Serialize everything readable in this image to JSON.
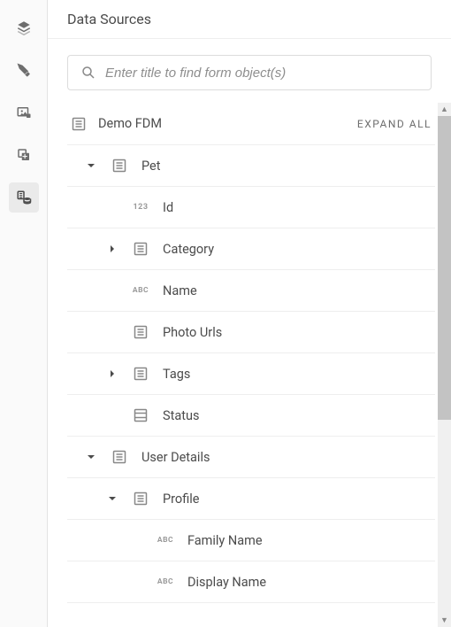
{
  "header": {
    "title": "Data Sources"
  },
  "search": {
    "placeholder": "Enter title to find form object(s)"
  },
  "root": {
    "label": "Demo FDM",
    "expand_all": "EXPAND ALL"
  },
  "nodes": [
    {
      "label": "Pet",
      "level": 1,
      "type": "object",
      "expanded": true,
      "has_children": true
    },
    {
      "label": "Id",
      "level": 2,
      "type": "number",
      "expanded": false,
      "has_children": false
    },
    {
      "label": "Category",
      "level": 2,
      "type": "object",
      "expanded": false,
      "has_children": true
    },
    {
      "label": "Name",
      "level": 2,
      "type": "string",
      "expanded": false,
      "has_children": false
    },
    {
      "label": "Photo Urls",
      "level": 2,
      "type": "array",
      "expanded": false,
      "has_children": false
    },
    {
      "label": "Tags",
      "level": 2,
      "type": "object",
      "expanded": false,
      "has_children": true
    },
    {
      "label": "Status",
      "level": 2,
      "type": "enum",
      "expanded": false,
      "has_children": false
    },
    {
      "label": "User Details",
      "level": 1,
      "type": "object",
      "expanded": true,
      "has_children": true
    },
    {
      "label": "Profile",
      "level": 2,
      "type": "object",
      "expanded": true,
      "has_children": true
    },
    {
      "label": "Family Name",
      "level": 3,
      "type": "string",
      "expanded": false,
      "has_children": false
    },
    {
      "label": "Display Name",
      "level": 3,
      "type": "string",
      "expanded": false,
      "has_children": false
    }
  ],
  "rail": {
    "active_index": 4,
    "items": [
      {
        "name": "layers-icon",
        "title": "Layers"
      },
      {
        "name": "wrench-icon",
        "title": "Tools"
      },
      {
        "name": "image-icon",
        "title": "Assets"
      },
      {
        "name": "copy-add-icon",
        "title": "Components"
      },
      {
        "name": "data-sources-icon",
        "title": "Data Sources"
      }
    ]
  },
  "colors": {
    "text": "#4b4b4b",
    "muted": "#8e8e8e",
    "border": "#e3e3e3",
    "rail_bg": "#fafafa"
  },
  "scrollbar": {
    "thumb_ratio": 0.61
  }
}
